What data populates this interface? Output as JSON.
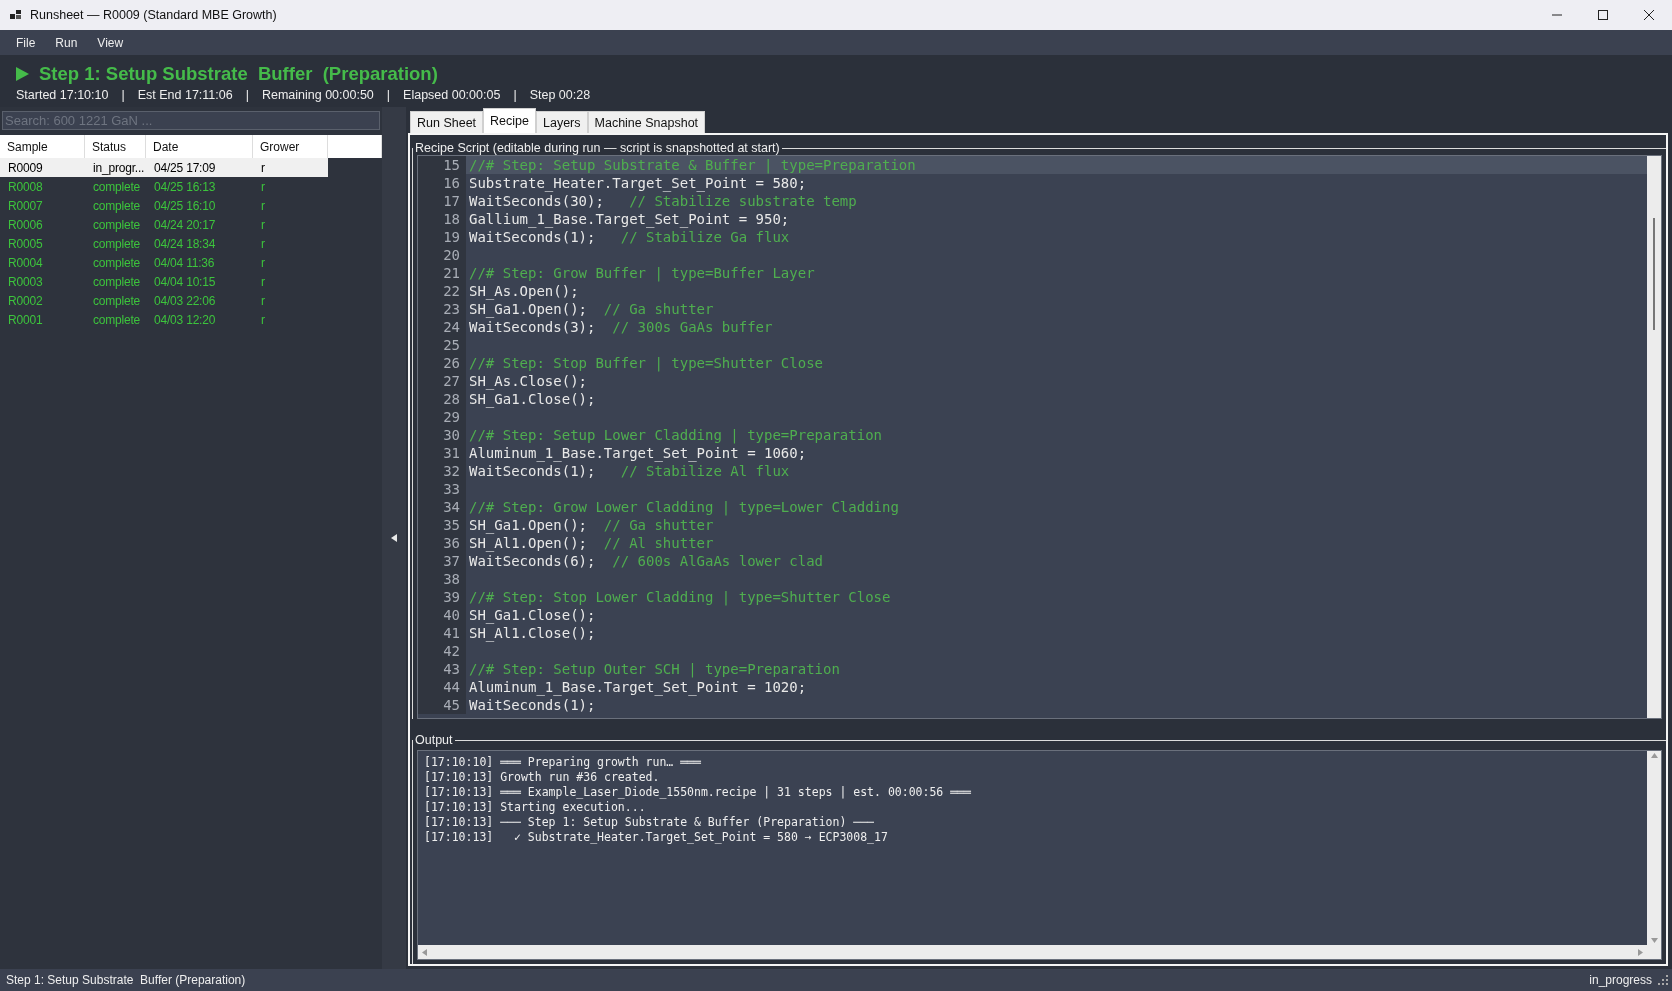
{
  "window": {
    "title": "Runsheet — R0009 (Standard MBE Growth)"
  },
  "menu": [
    "File",
    "Run",
    "View"
  ],
  "header": {
    "title": "Step 1: Setup Substrate  Buffer  (Preparation)",
    "stats": [
      "Started 17:10:10",
      "|",
      "Est End 17:11:06",
      "|",
      "Remaining 00:00:50",
      "|",
      "Elapsed 00:00:05",
      "|",
      "Step 00:28"
    ]
  },
  "sample_table": {
    "search_placeholder": "Search: 600 1221 GaN ...",
    "columns": [
      "Sample",
      "Status",
      "Date",
      "Grower"
    ],
    "rows": [
      {
        "cells": [
          "R0009",
          "in_progr...",
          "04/25 17:09",
          "r"
        ],
        "selected": true,
        "color": "#000000"
      },
      {
        "cells": [
          "R0008",
          "complete",
          "04/25 16:13",
          "r"
        ],
        "selected": false,
        "color": "#3cc43c"
      },
      {
        "cells": [
          "R0007",
          "complete",
          "04/25 16:10",
          "r"
        ],
        "selected": false,
        "color": "#3cc43c"
      },
      {
        "cells": [
          "R0006",
          "complete",
          "04/24 20:17",
          "r"
        ],
        "selected": false,
        "color": "#3cc43c"
      },
      {
        "cells": [
          "R0005",
          "complete",
          "04/24 18:34",
          "r"
        ],
        "selected": false,
        "color": "#3cc43c"
      },
      {
        "cells": [
          "R0004",
          "complete",
          "04/04 11:36",
          "r"
        ],
        "selected": false,
        "color": "#3cc43c"
      },
      {
        "cells": [
          "R0003",
          "complete",
          "04/04 10:15",
          "r"
        ],
        "selected": false,
        "color": "#3cc43c"
      },
      {
        "cells": [
          "R0002",
          "complete",
          "04/03 22:06",
          "r"
        ],
        "selected": false,
        "color": "#3cc43c"
      },
      {
        "cells": [
          "R0001",
          "complete",
          "04/03 12:20",
          "r"
        ],
        "selected": false,
        "color": "#3cc43c"
      }
    ]
  },
  "tabs": [
    {
      "label": "Run Sheet",
      "selected": false
    },
    {
      "label": "Recipe",
      "selected": true
    },
    {
      "label": "Layers",
      "selected": false
    },
    {
      "label": "Machine Snapshot",
      "selected": false
    }
  ],
  "recipe": {
    "title": "Recipe Script (editable during run — script is snapshotted at start)",
    "lines": [
      {
        "number": "15",
        "comment": "//# Step: Setup Substrate & Buffer | type=Preparation",
        "selected": true
      },
      {
        "number": "16",
        "code": "Substrate_Heater.Target_Set_Point = 580;",
        "selected": false
      },
      {
        "number": "17",
        "code": "WaitSeconds(30);   ",
        "comment": "// Stabilize substrate temp",
        "selected": false
      },
      {
        "number": "18",
        "code": "Gallium_1_Base.Target_Set_Point = 950;",
        "selected": false
      },
      {
        "number": "19",
        "code": "WaitSeconds(1);   ",
        "comment": "// Stabilize Ga flux",
        "selected": false
      },
      {
        "number": "20",
        "selected": false
      },
      {
        "number": "21",
        "comment": "//# Step: Grow Buffer | type=Buffer Layer",
        "selected": false
      },
      {
        "number": "22",
        "code": "SH_As.Open();",
        "selected": false
      },
      {
        "number": "23",
        "code": "SH_Ga1.Open();  ",
        "comment": "// Ga shutter",
        "selected": false
      },
      {
        "number": "24",
        "code": "WaitSeconds(3);  ",
        "comment": "// 300s GaAs buffer",
        "selected": false
      },
      {
        "number": "25",
        "selected": false
      },
      {
        "number": "26",
        "comment": "//# Step: Stop Buffer | type=Shutter Close",
        "selected": false
      },
      {
        "number": "27",
        "code": "SH_As.Close();",
        "selected": false
      },
      {
        "number": "28",
        "code": "SH_Ga1.Close();",
        "selected": false
      },
      {
        "number": "29",
        "selected": false
      },
      {
        "number": "30",
        "comment": "//# Step: Setup Lower Cladding | type=Preparation",
        "selected": false
      },
      {
        "number": "31",
        "code": "Aluminum_1_Base.Target_Set_Point = 1060;",
        "selected": false
      },
      {
        "number": "32",
        "code": "WaitSeconds(1);   ",
        "comment": "// Stabilize Al flux",
        "selected": false
      },
      {
        "number": "33",
        "selected": false
      },
      {
        "number": "34",
        "comment": "//# Step: Grow Lower Cladding | type=Lower Cladding",
        "selected": false
      },
      {
        "number": "35",
        "code": "SH_Ga1.Open();  ",
        "comment": "// Ga shutter",
        "selected": false
      },
      {
        "number": "36",
        "code": "SH_Al1.Open();  ",
        "comment": "// Al shutter",
        "selected": false
      },
      {
        "number": "37",
        "code": "WaitSeconds(6);  ",
        "comment": "// 600s AlGaAs lower clad",
        "selected": false
      },
      {
        "number": "38",
        "selected": false
      },
      {
        "number": "39",
        "comment": "//# Step: Stop Lower Cladding | type=Shutter Close",
        "selected": false
      },
      {
        "number": "40",
        "code": "SH_Ga1.Close();",
        "selected": false
      },
      {
        "number": "41",
        "code": "SH_Al1.Close();",
        "selected": false
      },
      {
        "number": "42",
        "selected": false
      },
      {
        "number": "43",
        "comment": "//# Step: Setup Outer SCH | type=Preparation",
        "selected": false
      },
      {
        "number": "44",
        "code": "Aluminum_1_Base.Target_Set_Point = 1020;",
        "selected": false
      },
      {
        "number": "45",
        "code": "WaitSeconds(1);",
        "selected": false
      }
    ]
  },
  "output": {
    "title": "Output",
    "lines": [
      "[17:10:10] ═══ Preparing growth run… ═══",
      "[17:10:13] Growth run #36 created.",
      "[17:10:13] ═══ Example_Laser_Diode_1550nm.recipe | 31 steps | est. 00:00:56 ═══",
      "[17:10:13] Starting execution...",
      "[17:10:13] ─── Step 1: Setup Substrate & Buffer (Preparation) ───",
      "[17:10:13]   ✓ Substrate_Heater.Target_Set_Point = 580 → ECP3008_17"
    ]
  },
  "status_bar": {
    "left": "Step 1: Setup Substrate  Buffer (Preparation)",
    "right": "in_progress"
  }
}
